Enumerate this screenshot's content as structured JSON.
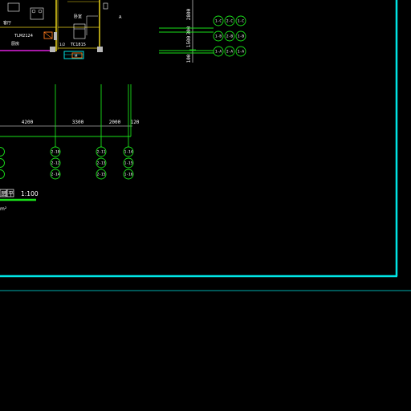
{
  "colors": {
    "background": "#000000",
    "axis_green": "#19e019",
    "frame_cyan": "#00e5e5",
    "wall_yellow": "#e8d21a",
    "wall_magenta": "#e020e0",
    "door_orange": "#ff7a1a",
    "text_white": "#ffffff"
  },
  "plan": {
    "room_label_1": "客厅",
    "window_label_1": "TLM2124",
    "room_label_2": "卧室",
    "room_label_3": "厨房",
    "window_label_2": "TC1815",
    "small_label": "1/2",
    "side_label": "A",
    "door_mark_label": "M"
  },
  "right_dimensions": [
    "2800",
    "300",
    "1500",
    "100"
  ],
  "right_axes": [
    [
      "1-C",
      "2-C",
      "1-C"
    ],
    [
      "1-B",
      "2-B",
      "1-B"
    ],
    [
      "1-A",
      "2-A",
      "1-A"
    ]
  ],
  "bottom_dimensions": [
    "4200",
    "3300",
    "2000",
    "120"
  ],
  "bottom_axes": [
    [
      "2-10",
      "2-12",
      "2-14"
    ],
    [
      "2-11",
      "2-13",
      "2-15"
    ],
    [
      "1-14",
      "1-15",
      "1-16"
    ],
    [
      "1-13",
      "1-14",
      "1-15"
    ]
  ],
  "title_block": {
    "label_a": "层",
    "label_b": "平",
    "scale": "1:100"
  },
  "area_unit": "m²"
}
